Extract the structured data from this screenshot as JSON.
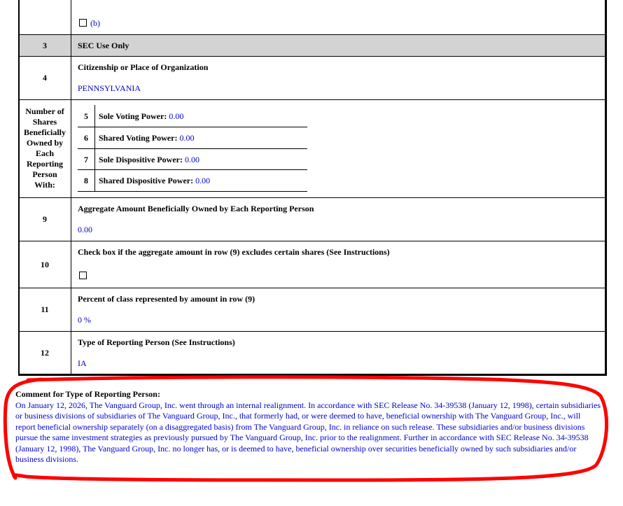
{
  "row_2": {
    "option_b": "(b)"
  },
  "row_3": {
    "number": "3",
    "label": "SEC Use Only"
  },
  "row_4": {
    "number": "4",
    "label": "Citizenship or Place of Organization",
    "value": "PENNSYLVANIA"
  },
  "shares": {
    "label": "Number of Shares Beneficially Owned by Each Reporting Person With:",
    "label_lines": [
      "Number of",
      "Shares",
      "Beneficially",
      "Owned by",
      "Each",
      "Reporting",
      "Person",
      "With:"
    ],
    "items": [
      {
        "number": "5",
        "label": "Sole Voting Power:",
        "value": "0.00"
      },
      {
        "number": "6",
        "label": "Shared Voting Power:",
        "value": "0.00"
      },
      {
        "number": "7",
        "label": "Sole Dispositive Power:",
        "value": "0.00"
      },
      {
        "number": "8",
        "label": "Shared Dispositive Power:",
        "value": "0.00"
      }
    ]
  },
  "row_9": {
    "number": "9",
    "label": "Aggregate Amount Beneficially Owned by Each Reporting Person",
    "value": "0.00"
  },
  "row_10": {
    "number": "10",
    "label": "Check box if the aggregate amount in row (9) excludes certain shares (See Instructions)"
  },
  "row_11": {
    "number": "11",
    "label": "Percent of class represented by amount in row (9)",
    "value": "0 %"
  },
  "row_12": {
    "number": "12",
    "label": "Type of Reporting Person (See Instructions)",
    "value": "IA"
  },
  "comment": {
    "title": "Comment for Type of Reporting Person:",
    "text": "On January 12, 2026, The Vanguard Group, Inc. went through an internal realignment. In accordance with SEC Release No. 34-39538 (January 12, 1998), certain subsidiaries or business divisions of subsidiaries of The Vanguard Group, Inc., that formerly had, or were deemed to have, beneficial ownership with The Vanguard Group, Inc., will report beneficial ownership separately (on a disaggregated basis) from The Vanguard Group, Inc. in reliance on such release. These subsidiaries and/or business divisions pursue the same investment strategies as previously pursued by The Vanguard Group, Inc. prior to the realignment. Further in accordance with SEC Release No. 34-39538 (January 12, 1998), The Vanguard Group, Inc. no longer has, or is deemed to have, beneficial ownership over securities beneficially owned by such subsidiaries and/or business divisions."
  },
  "annotation_color": "#ff0000"
}
